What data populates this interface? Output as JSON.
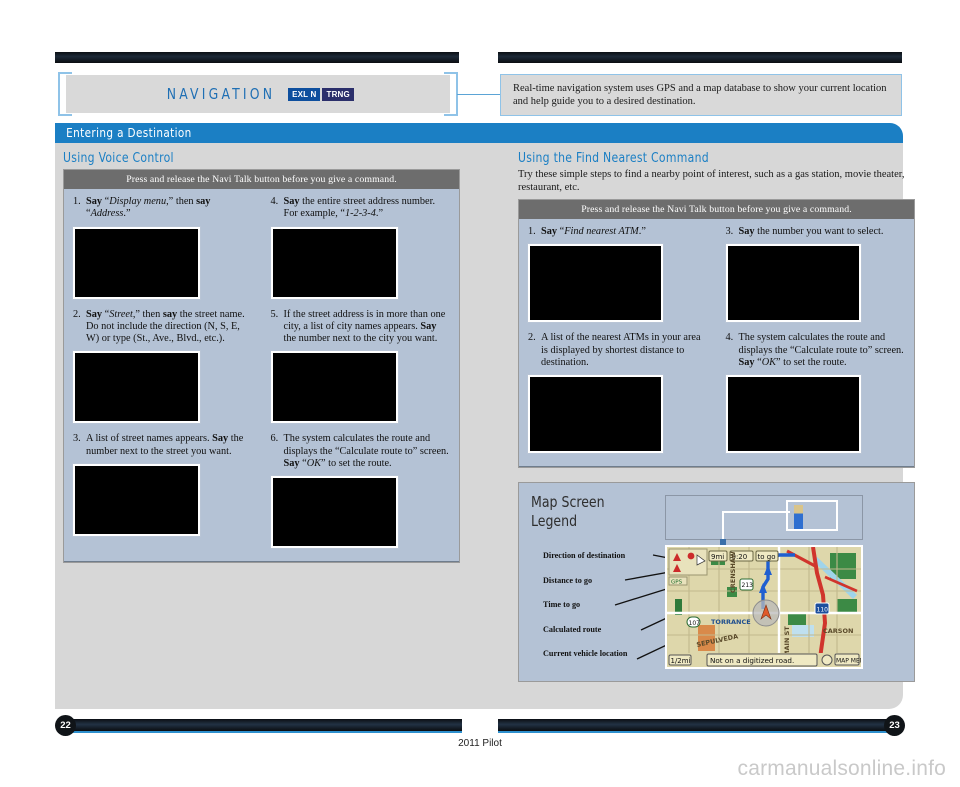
{
  "header": {
    "title": "NAVIGATION",
    "badges": [
      {
        "label": "EXL N",
        "color": "#0d4f9e"
      },
      {
        "label": "TRNG",
        "color": "#2b2f6b"
      }
    ],
    "intro": "Real-time navigation system uses GPS and a map database to show your current location and help guide you to a desired destination."
  },
  "section": {
    "title": "Entering a Destination"
  },
  "left": {
    "subhead": "Using Voice Control",
    "instruction_bar": "Press and release the Navi Talk button before you give a command.",
    "steps_col1": [
      {
        "num": "1.",
        "html": "<b>Say</b> “<i>Display menu</i>,” then <b>say</b> “<i>Address</i>.”"
      },
      {
        "num": "2.",
        "html": "<b>Say</b> “<i>Street</i>,” then <b>say</b> the street name. Do not include the direction (N, S, E, W) or type (St., Ave., Blvd., etc.)."
      },
      {
        "num": "3.",
        "html": "A list of street names appears. <b>Say</b> the number next to the street you want."
      }
    ],
    "steps_col2": [
      {
        "num": "4.",
        "html": "<b>Say</b> the entire street address number. For example, “<i>1-2-3-4</i>.”"
      },
      {
        "num": "5.",
        "html": "If the street address is in more than one city, a list of city names appears. <b>Say</b> the number next to the city you want."
      },
      {
        "num": "6.",
        "html": "The system calculates the route and displays the “Calculate route to” screen. <b>Say</b> “<i>OK</i>” to set the route."
      }
    ]
  },
  "right": {
    "subhead": "Using the Find Nearest Command",
    "lead": "Try these simple steps to find a nearby point of interest, such as a gas station, movie theater, restaurant, etc.",
    "instruction_bar": "Press and release the Navi Talk button before you give a command.",
    "steps_col1": [
      {
        "num": "1.",
        "html": "<b>Say</b> “<i>Find nearest ATM</i>.”"
      },
      {
        "num": "2.",
        "html": "A list of the nearest ATMs in your area is displayed by shortest distance to destination."
      }
    ],
    "steps_col2": [
      {
        "num": "3.",
        "html": "<b>Say</b> the number you want to select."
      },
      {
        "num": "4.",
        "html": "The system calculates the route and displays the “Calculate route to” screen. <b>Say</b> “<i>OK</i>” to set the route."
      }
    ]
  },
  "legend": {
    "title_line1": "Map Screen",
    "title_line2": "Legend",
    "labels": [
      "Direction of destination",
      "Distance to go",
      "Time to go",
      "Calculated route",
      "Current vehicle location"
    ],
    "map": {
      "status_text": "Not on a digitized road.",
      "scale": "1/2mi",
      "distance_to_go": "9mi",
      "time_to_go": "0:20",
      "to_go_label": "to go",
      "map_menu_button": "MAP MENU",
      "place_labels": [
        "TORRANCE",
        "CARSON",
        "SEPULVEDA",
        "CRENSHAW"
      ],
      "route_shields": [
        "213",
        "110",
        "107"
      ]
    }
  },
  "footer": {
    "page_left": "22",
    "page_right": "23",
    "model": "2011 Pilot",
    "watermark": "carmanualsonline.info"
  },
  "colors": {
    "accent_blue": "#1b7fc4",
    "panel_blue": "#b4c2d5",
    "band_gray": "#d7d7d7",
    "bar_gray": "#6d6d6d"
  }
}
